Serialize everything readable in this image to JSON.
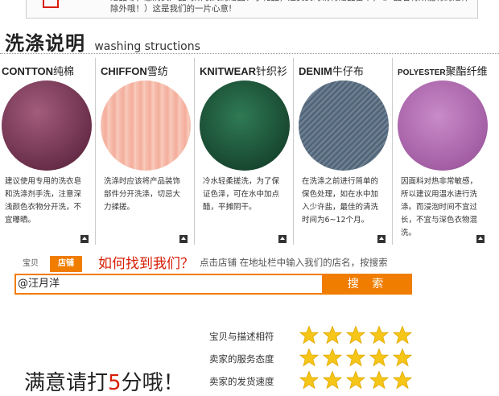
{
  "notice": {
    "text": "赠品等，忽购买产品时所收到的赠品、小礼品，退货货时请将赠品备下，（产品若有所能有的赠件除外哦！）这是我们的一片心意!"
  },
  "section": {
    "title_cn": "洗涤说明",
    "title_en": "washing structions"
  },
  "cards": [
    {
      "en": "CONTTON",
      "cn": "纯棉",
      "color": "#7b3b58",
      "desc": "建议使用专用的洗衣皂和洗涤剂手洗，注意深浅颜色衣物分开洗，不宜曝晒。"
    },
    {
      "en": "CHIFFON",
      "cn": "雪纺",
      "color": "#f4b3a3",
      "desc": "洗涤时应该将产品装饰部件分开洗涤，切忌大力揉搓。"
    },
    {
      "en": "KNITWEAR",
      "cn": "针织衫",
      "color": "#1f5b3e",
      "desc": "冷水轻柔搓洗，为了保证色泽，可在水中加点醋，平摊阴干。"
    },
    {
      "en": "DENIM",
      "cn": "牛仔布",
      "color": "#4a5f73",
      "desc": "在洗涤之前进行简单的保色处理，如在水中加入少许盐，最佳的清洗时间为6~12个月。"
    },
    {
      "en": "POLYESTER",
      "cn": "聚酯纤维",
      "color": "#b36ab3",
      "desc": "因面料对热非常敏感，所以建议用温水进行洗涤。而浸泡时间不宜过长，不宜与深色衣物混洗。"
    }
  ],
  "search": {
    "tab_baobei": "宝贝",
    "tab_dianpu": "店铺",
    "heading": "如何找到我们？",
    "hint": "点击店铺 在地址栏中输入我们的店名，按搜索",
    "input_value": "@汪月洋",
    "button": "搜 索"
  },
  "ratings": [
    {
      "label": "宝贝与描述相符",
      "stars": 5
    },
    {
      "label": "卖家的服务态度",
      "stars": 5
    },
    {
      "label": "卖家的发货速度",
      "stars": 5
    }
  ],
  "footer": {
    "pre": "满意请打",
    "num": "5",
    "post": "分哦！"
  },
  "colors": {
    "accent": "#f07d00",
    "red": "#d81e06",
    "star": "#f5c518"
  }
}
